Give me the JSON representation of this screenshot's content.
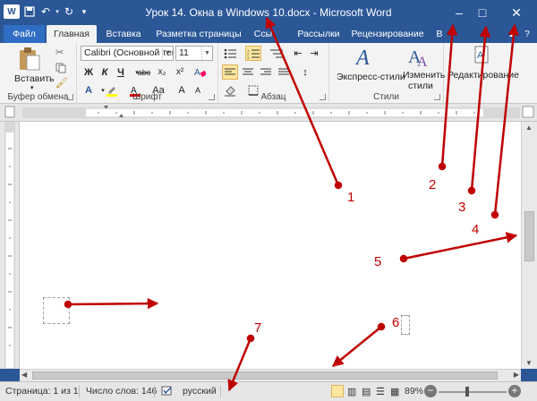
{
  "window": {
    "title": "Урок 14. Окна в Windows 10.docx - Microsoft Word"
  },
  "quick_access": {
    "app_icon": "word-icon",
    "icons": [
      "save-icon",
      "undo-icon",
      "redo-icon",
      "customize-icon"
    ]
  },
  "window_controls": {
    "minimize": "–",
    "maximize": "□",
    "close": "✕"
  },
  "tabs": [
    {
      "label": "Файл"
    },
    {
      "label": "Главная"
    },
    {
      "label": "Вставка"
    },
    {
      "label": "Разметка страницы"
    },
    {
      "label": "Ссы"
    },
    {
      "label": "Рассылки"
    },
    {
      "label": "Рецензирование"
    },
    {
      "label": "В"
    }
  ],
  "ribbon": {
    "clipboard": {
      "paste_label": "Вставить",
      "group_label": "Буфер обмена"
    },
    "font": {
      "font_name": "Calibri (Основной тек",
      "font_size": "11",
      "bold": "Ж",
      "italic": "К",
      "underline": "Ч",
      "strike": "abc",
      "subscript": "x₂",
      "superscript": "x²",
      "grow": "A",
      "shrink": "A",
      "case": "Aa",
      "group_label": "Шрифт"
    },
    "paragraph": {
      "group_label": "Абзац"
    },
    "styles": {
      "express_label": "Экспресс-стили",
      "change_label_1": "Изменить",
      "change_label_2": "стили",
      "group_label": "Стили"
    },
    "editing": {
      "label": "Редактирование"
    }
  },
  "status": {
    "page": "Страница: 1 из 1",
    "words": "Число слов: 146",
    "language": "русский",
    "zoom": "89%",
    "zoom_minus": "−",
    "zoom_plus": "+"
  },
  "annotations": {
    "labels": [
      "1",
      "2",
      "3",
      "4",
      "5",
      "6",
      "7"
    ],
    "color": "#c00000"
  },
  "colors": {
    "titlebar": "#2b5797",
    "ribbon": "#f3f3f3",
    "page": "#ffffff"
  }
}
